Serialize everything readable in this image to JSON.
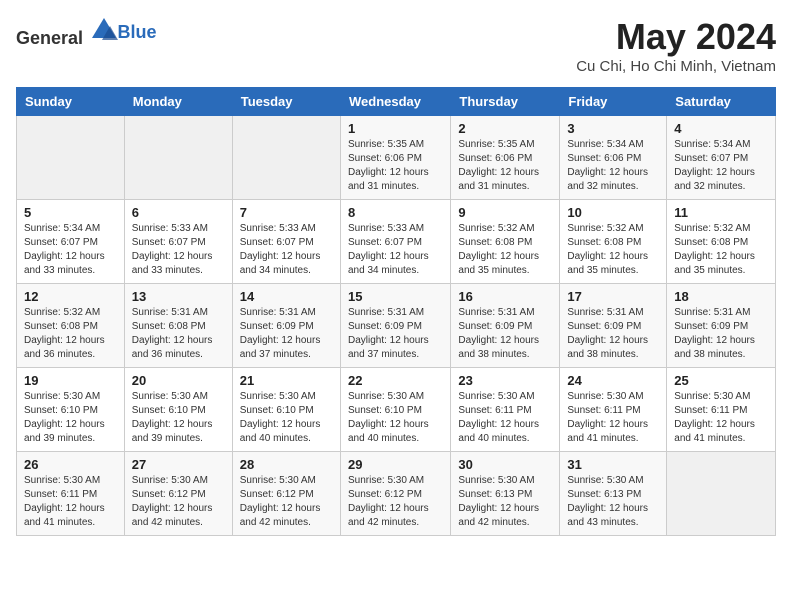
{
  "header": {
    "logo_general": "General",
    "logo_blue": "Blue",
    "title": "May 2024",
    "subtitle": "Cu Chi, Ho Chi Minh, Vietnam"
  },
  "weekdays": [
    "Sunday",
    "Monday",
    "Tuesday",
    "Wednesday",
    "Thursday",
    "Friday",
    "Saturday"
  ],
  "weeks": [
    [
      {
        "day": "",
        "info": ""
      },
      {
        "day": "",
        "info": ""
      },
      {
        "day": "",
        "info": ""
      },
      {
        "day": "1",
        "info": "Sunrise: 5:35 AM\nSunset: 6:06 PM\nDaylight: 12 hours\nand 31 minutes."
      },
      {
        "day": "2",
        "info": "Sunrise: 5:35 AM\nSunset: 6:06 PM\nDaylight: 12 hours\nand 31 minutes."
      },
      {
        "day": "3",
        "info": "Sunrise: 5:34 AM\nSunset: 6:06 PM\nDaylight: 12 hours\nand 32 minutes."
      },
      {
        "day": "4",
        "info": "Sunrise: 5:34 AM\nSunset: 6:07 PM\nDaylight: 12 hours\nand 32 minutes."
      }
    ],
    [
      {
        "day": "5",
        "info": "Sunrise: 5:34 AM\nSunset: 6:07 PM\nDaylight: 12 hours\nand 33 minutes."
      },
      {
        "day": "6",
        "info": "Sunrise: 5:33 AM\nSunset: 6:07 PM\nDaylight: 12 hours\nand 33 minutes."
      },
      {
        "day": "7",
        "info": "Sunrise: 5:33 AM\nSunset: 6:07 PM\nDaylight: 12 hours\nand 34 minutes."
      },
      {
        "day": "8",
        "info": "Sunrise: 5:33 AM\nSunset: 6:07 PM\nDaylight: 12 hours\nand 34 minutes."
      },
      {
        "day": "9",
        "info": "Sunrise: 5:32 AM\nSunset: 6:08 PM\nDaylight: 12 hours\nand 35 minutes."
      },
      {
        "day": "10",
        "info": "Sunrise: 5:32 AM\nSunset: 6:08 PM\nDaylight: 12 hours\nand 35 minutes."
      },
      {
        "day": "11",
        "info": "Sunrise: 5:32 AM\nSunset: 6:08 PM\nDaylight: 12 hours\nand 35 minutes."
      }
    ],
    [
      {
        "day": "12",
        "info": "Sunrise: 5:32 AM\nSunset: 6:08 PM\nDaylight: 12 hours\nand 36 minutes."
      },
      {
        "day": "13",
        "info": "Sunrise: 5:31 AM\nSunset: 6:08 PM\nDaylight: 12 hours\nand 36 minutes."
      },
      {
        "day": "14",
        "info": "Sunrise: 5:31 AM\nSunset: 6:09 PM\nDaylight: 12 hours\nand 37 minutes."
      },
      {
        "day": "15",
        "info": "Sunrise: 5:31 AM\nSunset: 6:09 PM\nDaylight: 12 hours\nand 37 minutes."
      },
      {
        "day": "16",
        "info": "Sunrise: 5:31 AM\nSunset: 6:09 PM\nDaylight: 12 hours\nand 38 minutes."
      },
      {
        "day": "17",
        "info": "Sunrise: 5:31 AM\nSunset: 6:09 PM\nDaylight: 12 hours\nand 38 minutes."
      },
      {
        "day": "18",
        "info": "Sunrise: 5:31 AM\nSunset: 6:09 PM\nDaylight: 12 hours\nand 38 minutes."
      }
    ],
    [
      {
        "day": "19",
        "info": "Sunrise: 5:30 AM\nSunset: 6:10 PM\nDaylight: 12 hours\nand 39 minutes."
      },
      {
        "day": "20",
        "info": "Sunrise: 5:30 AM\nSunset: 6:10 PM\nDaylight: 12 hours\nand 39 minutes."
      },
      {
        "day": "21",
        "info": "Sunrise: 5:30 AM\nSunset: 6:10 PM\nDaylight: 12 hours\nand 40 minutes."
      },
      {
        "day": "22",
        "info": "Sunrise: 5:30 AM\nSunset: 6:10 PM\nDaylight: 12 hours\nand 40 minutes."
      },
      {
        "day": "23",
        "info": "Sunrise: 5:30 AM\nSunset: 6:11 PM\nDaylight: 12 hours\nand 40 minutes."
      },
      {
        "day": "24",
        "info": "Sunrise: 5:30 AM\nSunset: 6:11 PM\nDaylight: 12 hours\nand 41 minutes."
      },
      {
        "day": "25",
        "info": "Sunrise: 5:30 AM\nSunset: 6:11 PM\nDaylight: 12 hours\nand 41 minutes."
      }
    ],
    [
      {
        "day": "26",
        "info": "Sunrise: 5:30 AM\nSunset: 6:11 PM\nDaylight: 12 hours\nand 41 minutes."
      },
      {
        "day": "27",
        "info": "Sunrise: 5:30 AM\nSunset: 6:12 PM\nDaylight: 12 hours\nand 42 minutes."
      },
      {
        "day": "28",
        "info": "Sunrise: 5:30 AM\nSunset: 6:12 PM\nDaylight: 12 hours\nand 42 minutes."
      },
      {
        "day": "29",
        "info": "Sunrise: 5:30 AM\nSunset: 6:12 PM\nDaylight: 12 hours\nand 42 minutes."
      },
      {
        "day": "30",
        "info": "Sunrise: 5:30 AM\nSunset: 6:13 PM\nDaylight: 12 hours\nand 42 minutes."
      },
      {
        "day": "31",
        "info": "Sunrise: 5:30 AM\nSunset: 6:13 PM\nDaylight: 12 hours\nand 43 minutes."
      },
      {
        "day": "",
        "info": ""
      }
    ]
  ]
}
